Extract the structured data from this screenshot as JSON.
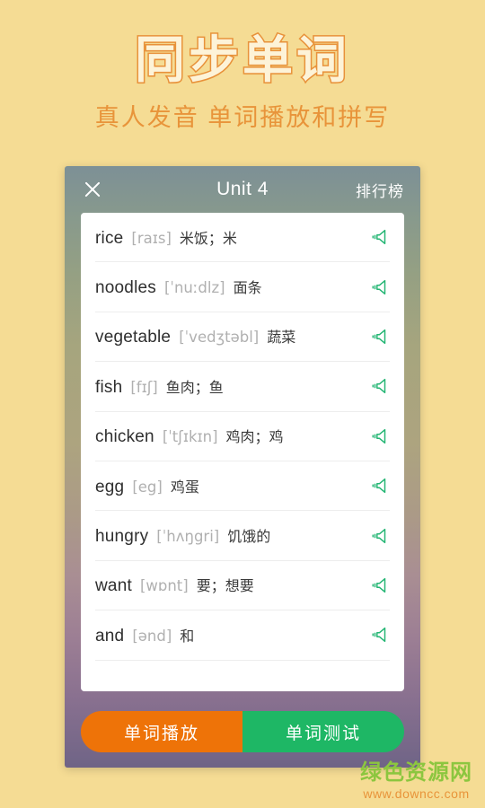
{
  "promo": {
    "title": "同步单词",
    "subtitle": "真人发音 单词播放和拼写",
    "title_fill_color": "#fdf3d8",
    "title_stroke_color": "#e8923a",
    "subtitle_color": "#e8943a",
    "page_background": "#f5dc94"
  },
  "app": {
    "header": {
      "close_icon": "close-icon",
      "title": "Unit 4",
      "rank_label": "排行榜"
    },
    "panel_gradient": [
      "#7d9096",
      "#ada47f",
      "#a98e93",
      "#6f6486"
    ],
    "word_list": {
      "speaker_icon": "speaker-icon",
      "speaker_color": "#23b573",
      "items": [
        {
          "word": "rice",
          "phonetic": "[raɪs]",
          "meaning": "米饭；米"
        },
        {
          "word": "noodles",
          "phonetic": "[ˈnuːdlz]",
          "meaning": "面条"
        },
        {
          "word": "vegetable",
          "phonetic": "[ˈvedʒtəbl]",
          "meaning": "蔬菜"
        },
        {
          "word": "fish",
          "phonetic": "[fɪʃ]",
          "meaning": "鱼肉；鱼"
        },
        {
          "word": "chicken",
          "phonetic": "[ˈtʃɪkɪn]",
          "meaning": "鸡肉；鸡"
        },
        {
          "word": "egg",
          "phonetic": "[eg]",
          "meaning": "鸡蛋"
        },
        {
          "word": "hungry",
          "phonetic": "[ˈhʌŋgri]",
          "meaning": "饥饿的"
        },
        {
          "word": "want",
          "phonetic": "[wɒnt]",
          "meaning": "要；想要"
        },
        {
          "word": "and",
          "phonetic": "[ənd]",
          "meaning": "和"
        }
      ]
    },
    "actions": {
      "play_label": "单词播放",
      "play_color": "#ee7308",
      "test_label": "单词测试",
      "test_color": "#1eb765"
    }
  },
  "watermark": {
    "site_name": "绿色资源网",
    "url": "www.downcc.com",
    "site_color": "#8cc63f",
    "url_color": "#e8943a"
  }
}
